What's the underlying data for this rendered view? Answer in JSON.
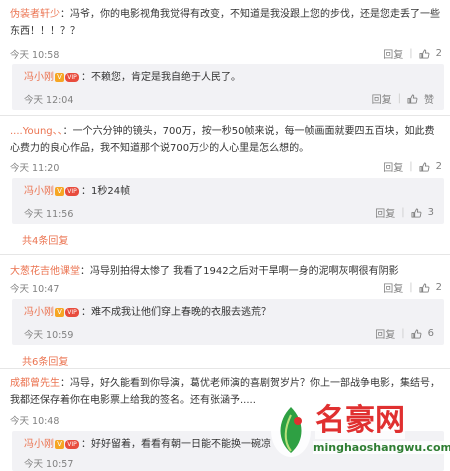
{
  "comments": [
    {
      "user": "伪装者轩少",
      "text": "：冯爷，你的电影视角我觉得有改变，不知道是我没跟上您的步伐，还是您走丢了一些东西！！！？？",
      "time": "今天 10:58",
      "reply_label": "回复",
      "like_count": "2",
      "reply": {
        "user": "冯小刚",
        "text": "：不赖您，肯定是我自绝于人民了。",
        "time": "今天 12:04",
        "reply_label": "回复",
        "like_label": "赞"
      }
    },
    {
      "user": "....Young、、",
      "text": "：一个六分钟的镜头，700万，按一秒50帧来说，每一帧画面就要四五百块，如此费心费力的良心作品，我不知道那个说700万少的人心里是怎么想的。",
      "time": "今天 11:20",
      "reply_label": "回复",
      "like_count": "2",
      "reply": {
        "user": "冯小刚",
        "text": "：1秒24帧",
        "time": "今天 11:56",
        "reply_label": "回复",
        "like_count": "3"
      },
      "more_replies": "共4条回复"
    },
    {
      "user": "大葱花吉他课堂",
      "text": "：冯导别拍得太惨了 我看了1942之后对干旱啊一身的泥啊灰啊很有阴影",
      "time": "今天 10:47",
      "reply_label": "回复",
      "like_count": "2",
      "reply": {
        "user": "冯小刚",
        "text": "：难不成我让他们穿上春晚的衣服去逃荒？",
        "time": "今天 10:59",
        "reply_label": "回复",
        "like_count": "6"
      },
      "more_replies": "共6条回复"
    },
    {
      "user": "成都曾先生",
      "text": "：冯导，好久能看到你导演，葛优老师演的喜剧贺岁片？你上一部战争电影，集结号，我都还保存着你在电影票上给我的签名。还有张涵予.....",
      "time": "今天 10:48",
      "reply": {
        "user": "冯小刚",
        "text": "：好好留着，看看有朝一日能不能换一碗凉",
        "time": "今天 10:57"
      }
    }
  ],
  "badges": {
    "v": "V",
    "vip": "VIP"
  },
  "watermark": {
    "brand": "名豪网",
    "url": "minghaoshangwu.com"
  },
  "colors": {
    "accent": "#eb7350",
    "reply_bg": "#f2f2f5",
    "meta": "#808080"
  }
}
